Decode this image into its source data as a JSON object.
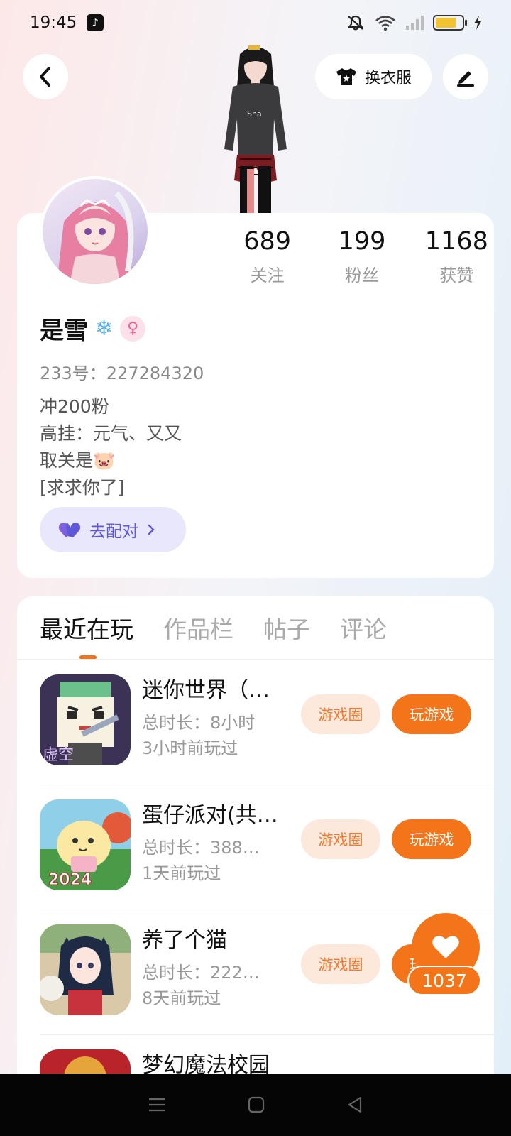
{
  "status_bar": {
    "time": "19:45"
  },
  "header": {
    "outfit_label": "换衣服"
  },
  "profile": {
    "stats": [
      {
        "value": "689",
        "label": "关注"
      },
      {
        "value": "199",
        "label": "粉丝"
      },
      {
        "value": "1168",
        "label": "获赞"
      }
    ],
    "username": "是雪",
    "user_id": "233号：227284320",
    "bio": [
      "冲200粉",
      "高挂：元气、又又",
      "取关是🐷",
      "[求求你了]"
    ],
    "match_label": "去配对"
  },
  "tabs": [
    "最近在玩",
    "作品栏",
    "帖子",
    "评论"
  ],
  "games": [
    {
      "title": "迷你世界（…",
      "duration": "总时长：8小时",
      "last_played": "3小时前玩过",
      "circle_label": "游戏圈",
      "play_label": "玩游戏"
    },
    {
      "title": "蛋仔派对(共…",
      "duration": "总时长：388…",
      "last_played": "1天前玩过",
      "circle_label": "游戏圈",
      "play_label": "玩游戏"
    },
    {
      "title": "养了个猫",
      "duration": "总时长：222…",
      "last_played": "8天前玩过",
      "circle_label": "游戏圈",
      "play_label": "玩游戏"
    },
    {
      "title": "梦幻魔法校园",
      "duration": "",
      "last_played": "",
      "circle_label": "",
      "play_label": ""
    }
  ],
  "game_icon_texts": {
    "minecraft_tag": "虚空",
    "eggy_year": "2024"
  },
  "like": {
    "count": "1037"
  },
  "colors": {
    "accent": "#f47519",
    "accent_light": "#fde8dc",
    "match": "#5f59d9",
    "match_bg": "#e9e7fb"
  },
  "icons": {
    "back": "chevron-left-icon",
    "outfit": "tshirt-icon",
    "edit": "pen-icon",
    "gender": "female-icon",
    "heart": "heart-icon"
  }
}
